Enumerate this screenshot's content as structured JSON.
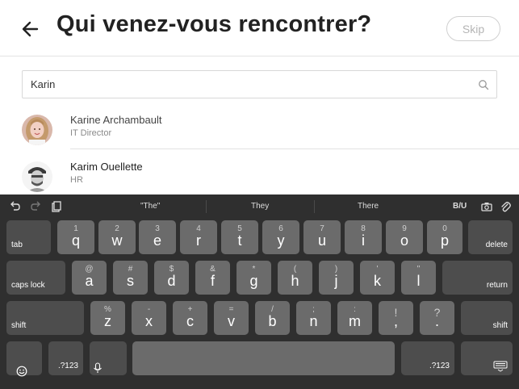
{
  "header": {
    "title": "Qui venez-vous rencontrer?",
    "skip_label": "Skip"
  },
  "search": {
    "value": "Karin"
  },
  "people": [
    {
      "name": "Karine Archambault",
      "role": "IT Director"
    },
    {
      "name": "Karim Ouellette",
      "role": "HR"
    }
  ],
  "keyboard": {
    "suggestions": [
      "\"The\"",
      "They",
      "There"
    ],
    "format_label": "B/U",
    "row1": [
      {
        "sub": "1",
        "main": "q"
      },
      {
        "sub": "2",
        "main": "w"
      },
      {
        "sub": "3",
        "main": "e"
      },
      {
        "sub": "4",
        "main": "r"
      },
      {
        "sub": "5",
        "main": "t"
      },
      {
        "sub": "6",
        "main": "y"
      },
      {
        "sub": "7",
        "main": "u"
      },
      {
        "sub": "8",
        "main": "i"
      },
      {
        "sub": "9",
        "main": "o"
      },
      {
        "sub": "0",
        "main": "p"
      }
    ],
    "row2": [
      {
        "sub": "@",
        "main": "a"
      },
      {
        "sub": "#",
        "main": "s"
      },
      {
        "sub": "$",
        "main": "d"
      },
      {
        "sub": "&",
        "main": "f"
      },
      {
        "sub": "*",
        "main": "g"
      },
      {
        "sub": "(",
        "main": "h"
      },
      {
        "sub": ")",
        "main": "j"
      },
      {
        "sub": "'",
        "main": "k"
      },
      {
        "sub": "\"",
        "main": "l"
      }
    ],
    "row3": [
      {
        "sub": "%",
        "main": "z"
      },
      {
        "sub": "-",
        "main": "x"
      },
      {
        "sub": "+",
        "main": "c"
      },
      {
        "sub": "=",
        "main": "v"
      },
      {
        "sub": "/",
        "main": "b"
      },
      {
        "sub": ";",
        "main": "n"
      },
      {
        "sub": ":",
        "main": "m"
      },
      {
        "sub": "!",
        "main": ","
      },
      {
        "sub": "?",
        "main": "."
      }
    ],
    "tab_label": "tab",
    "delete_label": "delete",
    "caps_label": "caps lock",
    "return_label": "return",
    "shift_label": "shift",
    "num_label": ".?123"
  }
}
